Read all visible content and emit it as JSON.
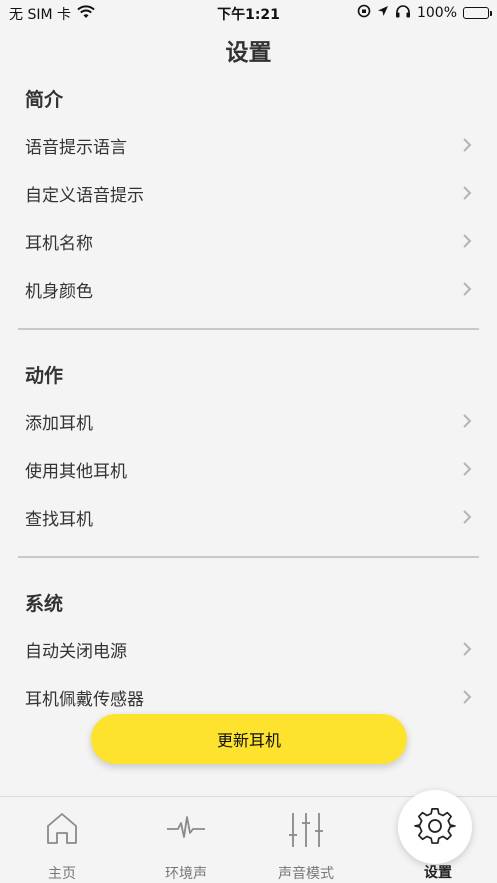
{
  "status_bar": {
    "carrier": "无 SIM 卡",
    "time": "下午1:21",
    "battery": "100%",
    "battery_level": 1.0
  },
  "header": {
    "title": "设置"
  },
  "sections": [
    {
      "title": "简介",
      "items": [
        {
          "label": "语音提示语言"
        },
        {
          "label": "自定义语音提示"
        },
        {
          "label": "耳机名称"
        },
        {
          "label": "机身颜色"
        }
      ]
    },
    {
      "title": "动作",
      "items": [
        {
          "label": "添加耳机"
        },
        {
          "label": "使用其他耳机"
        },
        {
          "label": "查找耳机"
        }
      ]
    },
    {
      "title": "系统",
      "items": [
        {
          "label": "自动关闭电源"
        },
        {
          "label": "耳机佩戴传感器"
        }
      ]
    }
  ],
  "update_button": {
    "label": "更新耳机"
  },
  "tab_bar": {
    "tabs": [
      {
        "label": "主页",
        "icon": "home-icon"
      },
      {
        "label": "环境声",
        "icon": "waveform-icon"
      },
      {
        "label": "声音模式",
        "icon": "equalizer-icon"
      },
      {
        "label": "设置",
        "icon": "gear-icon",
        "active": true
      }
    ]
  },
  "colors": {
    "accent": "#fde32e",
    "background": "#f4f4f4",
    "divider": "#c9c9c9"
  }
}
